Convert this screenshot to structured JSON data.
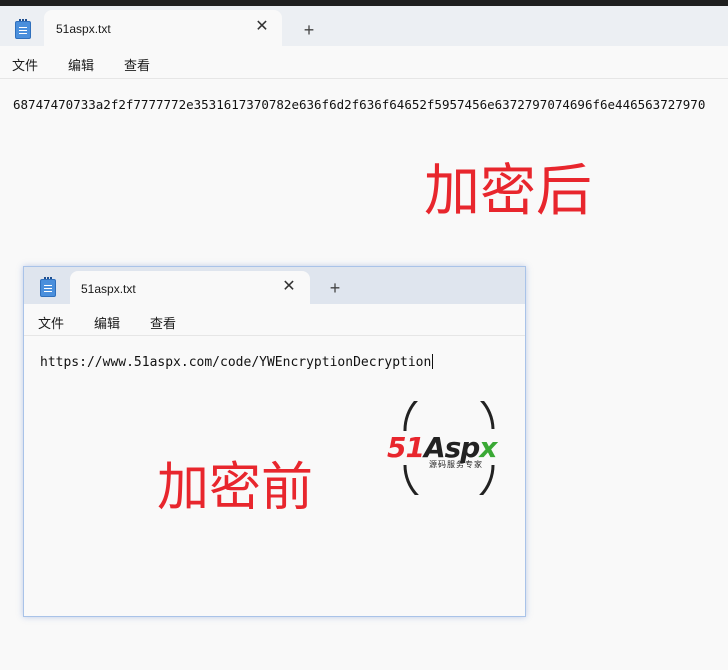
{
  "main_window": {
    "tab": {
      "title": "51aspx.txt",
      "close_glyph": "✕"
    },
    "new_tab_glyph": "+",
    "menu": {
      "file": "文件",
      "edit": "编辑",
      "view": "查看"
    },
    "content": "68747470733a2f2f7777772e3531617370782e636f6d2f636f64652f5957456e6372797074696f6e446563727970",
    "annotation": "加密后"
  },
  "inner_window": {
    "tab": {
      "title": "51aspx.txt",
      "close_glyph": "✕"
    },
    "new_tab_glyph": "+",
    "menu": {
      "file": "文件",
      "edit": "编辑",
      "view": "查看"
    },
    "content": "https://www.51aspx.com/code/YWEncryptionDecryption",
    "annotation": "加密前"
  },
  "logo": {
    "red_part": "51",
    "dark_part": "Asp",
    "green_part": "x",
    "subtitle": "源码服务专家",
    "colors": {
      "red": "#e8262d",
      "dark": "#222222",
      "green": "#3aa935"
    }
  },
  "colors": {
    "annotation_red": "#e8262d",
    "inner_window_border": "#a9c3e8"
  },
  "icons": [
    "notepad-icon",
    "close-icon",
    "plus-icon"
  ]
}
